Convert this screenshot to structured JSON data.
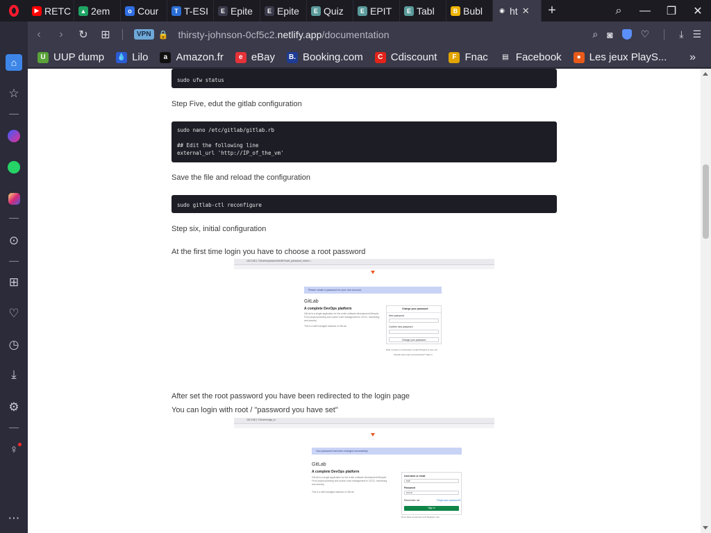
{
  "browser": {
    "tabs": [
      {
        "title": "RETC",
        "fav_color": "#ff0000",
        "fav_glyph": "▶"
      },
      {
        "title": "2em",
        "fav_color": "#1fa463",
        "fav_glyph": "▲"
      },
      {
        "title": "Cour",
        "fav_color": "#2f6fe4",
        "fav_glyph": "o"
      },
      {
        "title": "T-ESI",
        "fav_color": "#2b6fd6",
        "fav_glyph": "T"
      },
      {
        "title": "Epite",
        "fav_color": "#3a3a4a",
        "fav_glyph": "E"
      },
      {
        "title": "Epite",
        "fav_color": "#3a3a4a",
        "fav_glyph": "E"
      },
      {
        "title": "Quiz",
        "fav_color": "#5a9a9a",
        "fav_glyph": "E"
      },
      {
        "title": "EPIT",
        "fav_color": "#5a9a9a",
        "fav_glyph": "E"
      },
      {
        "title": "Tabl",
        "fav_color": "#5a9a9a",
        "fav_glyph": "E"
      },
      {
        "title": "Bubl",
        "fav_color": "#f0b400",
        "fav_glyph": "B"
      },
      {
        "title": "ht",
        "fav_color": "#3a3a4a",
        "fav_glyph": "◉"
      }
    ],
    "address": {
      "vpn_label": "VPN",
      "url_prefix": "thirsty-johnson-0cf5c2.",
      "url_domain": "netlify.app",
      "url_path": "/documentation"
    },
    "bookmarks": [
      {
        "label": "UUP dump",
        "fav_color": "#5aa33a",
        "fav_glyph": "U"
      },
      {
        "label": "Lilo",
        "fav_color": "#2b5cd6",
        "fav_glyph": "💧"
      },
      {
        "label": "Amazon.fr",
        "fav_color": "#111111",
        "fav_glyph": "a"
      },
      {
        "label": "eBay",
        "fav_color": "#e53238",
        "fav_glyph": "e"
      },
      {
        "label": "Booking.com",
        "fav_color": "#1e3c96",
        "fav_glyph": "B."
      },
      {
        "label": "Cdiscount",
        "fav_color": "#e2231a",
        "fav_glyph": "C"
      },
      {
        "label": "Fnac",
        "fav_color": "#e1a400",
        "fav_glyph": "F"
      },
      {
        "label": "Facebook",
        "fav_color": "#3a3a4a",
        "fav_glyph": "▤"
      },
      {
        "label": "Les jeux PlayS...",
        "fav_color": "#e85a1a",
        "fav_glyph": "●"
      }
    ]
  },
  "doc": {
    "code1": "sudo ufw status",
    "step5": "Step Five, edut the gitlab configuration",
    "code2": "sudo nano /etc/gitlab/gitlab.rb\n\n## Edit the following line\nexternal_url 'http://IP_of_the_vm'",
    "save_text": "Save the file and reload the configuration",
    "code3": "sudo gitlab-ctl reconfigure",
    "step6": "Step six, initial configuration",
    "root_pw_text": "At the first time login you have to choose a root password",
    "after_text": "After set the root password you have been redirected to the login page",
    "login_text": "You can login with root / \"password you have set\""
  },
  "shot1": {
    "url": "192.168.1.73/users/password/edit?reset_password_token=...",
    "banner": "Please create a password for your new account.",
    "title": "GitLab",
    "subtitle": "A complete DevOps platform",
    "desc": "GitLab is a single application for the entire software development lifecycle. From project planning and source code management to CI/CD, monitoring, and security.",
    "note": "This is a self-managed instance of GitLab.",
    "form_title": "Change your password",
    "new_pw": "New password",
    "confirm_pw": "Confirm new password",
    "btn": "Change your password",
    "link1": "Didn't receive a confirmation email? Request a new one",
    "link2": "Already have login and password? Sign in"
  },
  "shot2": {
    "url": "192.168.1.73/users/sign_in",
    "banner": "Your password has been changed successfully.",
    "title": "GitLab",
    "subtitle": "A complete DevOps platform",
    "desc": "GitLab is a single application for the entire software development lifecycle. From project planning and source code management to CI/CD, monitoring, and security.",
    "note": "This is a self-managed instance of GitLab.",
    "user_lbl": "Username or email",
    "user_val": "root",
    "pw_lbl": "Password",
    "pw_val": "••••••••",
    "remember": "Remember me",
    "forgot": "Forgot your password?",
    "btn": "Sign in",
    "link": "Don't have an account yet? Register now"
  }
}
